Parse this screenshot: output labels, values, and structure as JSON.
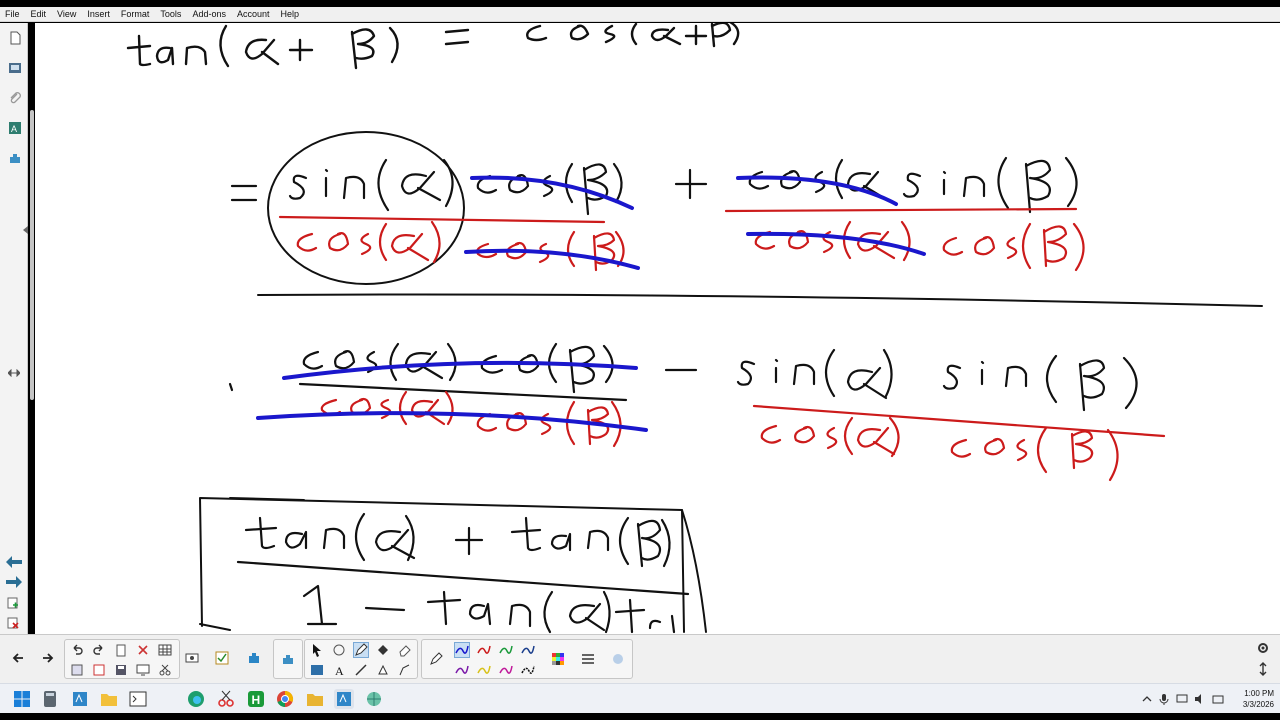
{
  "menu": [
    "File",
    "Edit",
    "View",
    "Insert",
    "Format",
    "Tools",
    "Add-ons",
    "Account",
    "Help"
  ],
  "clock": {
    "time": "1:00 PM",
    "date": "3/3/2026"
  },
  "colors": {
    "ink_black": "#111111",
    "ink_red": "#cc1b1b",
    "ink_blue": "#1a17cc",
    "toolbar_bg": "#f0f0f0",
    "taskbar_bg": "#eef1f6"
  },
  "icons": {
    "left_panel": [
      "page-sorter-icon",
      "gallery-icon",
      "attachments-icon",
      "properties-icon",
      "addons-icon"
    ],
    "toolbar": [
      "back-arrow-icon",
      "forward-arrow-icon",
      "undo-icon",
      "redo-icon",
      "delete-icon",
      "table-icon",
      "select-icon",
      "pen-icon",
      "fill-icon",
      "eraser-icon",
      "text-icon",
      "line-icon",
      "shape-icon",
      "settings-icon"
    ],
    "taskbar": [
      "windows-start-icon",
      "calculator-icon",
      "notebook-icon",
      "file-explorer-icon",
      "terminal-icon",
      "edge-icon",
      "snipping-icon",
      "app-h-icon",
      "chrome-icon",
      "folder-icon",
      "smart-notebook-icon",
      "globe-icon"
    ]
  }
}
